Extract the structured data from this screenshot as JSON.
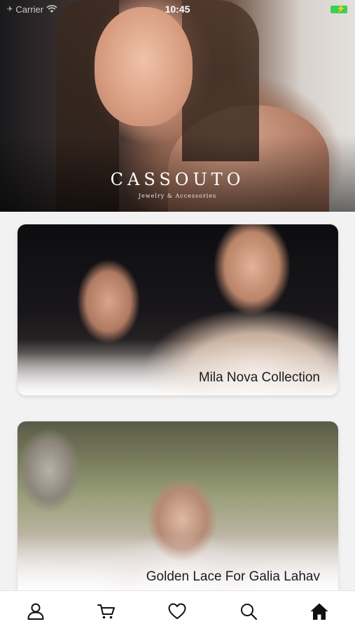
{
  "status_bar": {
    "carrier": "Carrier",
    "time": "10:45"
  },
  "hero": {
    "brand_name": "CASSOUTO",
    "tagline": "Jewelry & Accessories"
  },
  "collections": [
    {
      "title": "Mila Nova Collection"
    },
    {
      "title": "Golden Lace For Galia Lahav"
    }
  ],
  "tab_bar": {
    "tabs": [
      {
        "icon": "user-icon"
      },
      {
        "icon": "cart-icon"
      },
      {
        "icon": "heart-icon"
      },
      {
        "icon": "search-icon"
      },
      {
        "icon": "home-icon",
        "active": true
      }
    ]
  }
}
